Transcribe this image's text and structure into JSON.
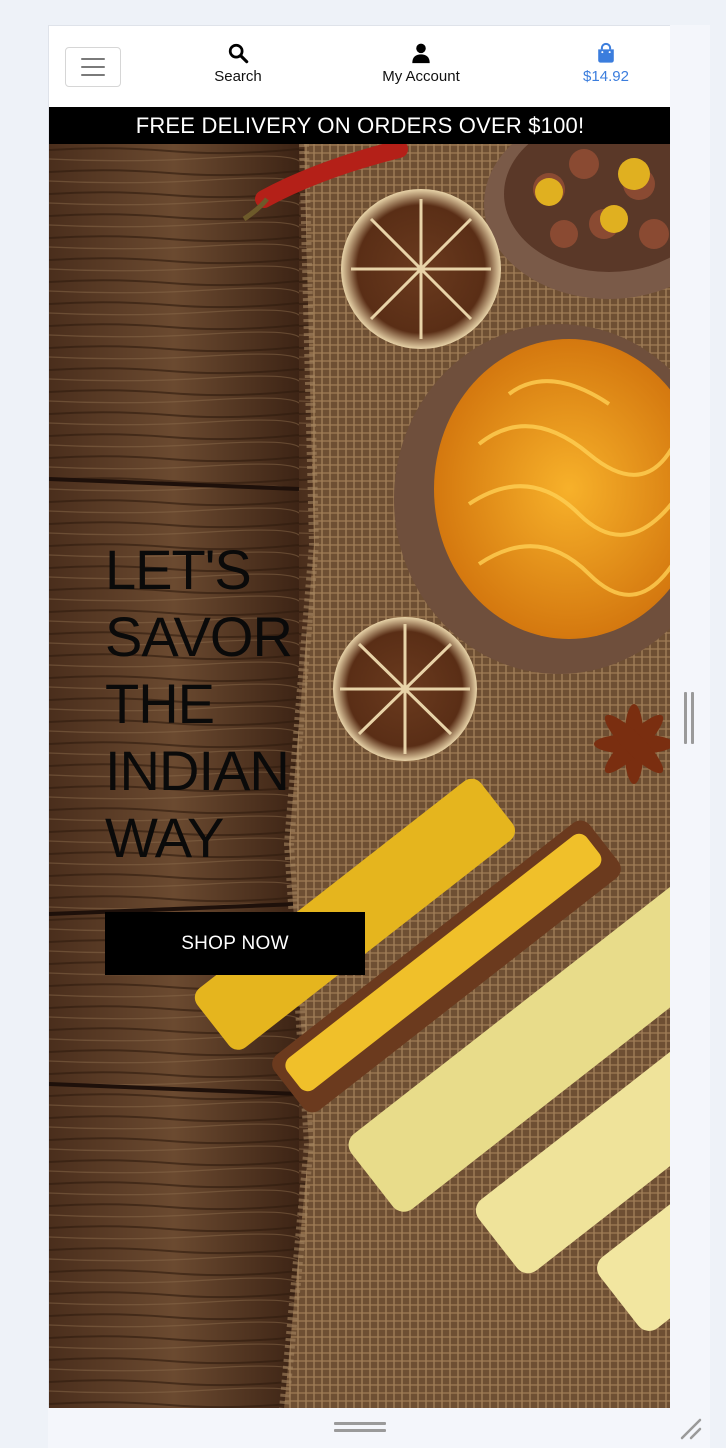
{
  "header": {
    "search_label": "Search",
    "account_label": "My Account",
    "cart_total": "$14.92",
    "menu_toggle_icon": "hamburger-icon",
    "search_icon": "search-icon",
    "account_icon": "user-icon",
    "cart_icon": "shopping-bag-icon"
  },
  "promo": {
    "text": "FREE DELIVERY ON ORDERS OVER $100!"
  },
  "hero": {
    "title_lines": [
      "LET'S",
      "SAVOR",
      "THE",
      "INDIAN",
      "WAY"
    ],
    "cta_label": "SHOP NOW"
  },
  "colors": {
    "accent": "#3b7ddd",
    "promo_bg": "#000000",
    "button_bg": "#000000"
  }
}
